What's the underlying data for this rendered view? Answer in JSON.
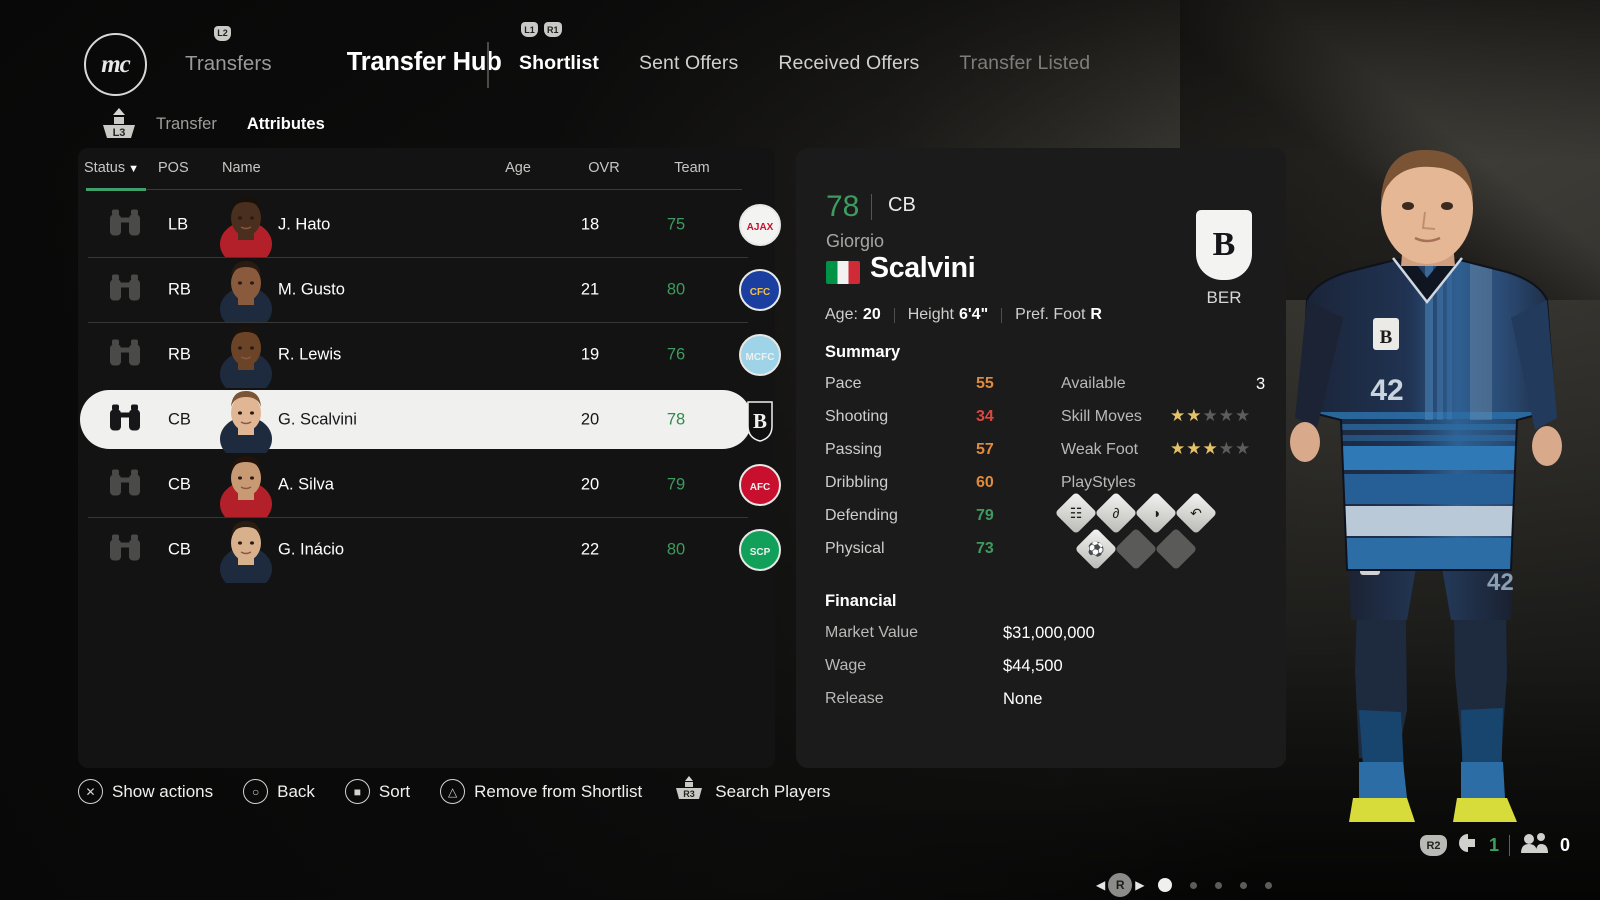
{
  "header": {
    "logo_text": "mc",
    "prev_label": "Transfers",
    "title": "Transfer Hub",
    "l2_tag": "L2",
    "l1_tag": "L1",
    "r1_tag": "R1",
    "tabs": [
      {
        "label": "Shortlist",
        "state": "active"
      },
      {
        "label": "Sent Offers",
        "state": "normal"
      },
      {
        "label": "Received Offers",
        "state": "normal"
      },
      {
        "label": "Transfer Listed",
        "state": "dim"
      }
    ]
  },
  "subnav": {
    "l3_tag": "L3",
    "items": [
      {
        "label": "Transfer",
        "state": "normal"
      },
      {
        "label": "Attributes",
        "state": "active"
      }
    ]
  },
  "list": {
    "columns": [
      "Status",
      "POS",
      "Name",
      "Age",
      "OVR",
      "Team"
    ],
    "sort_caret": "▼",
    "sort_column": "Status",
    "rows": [
      {
        "pos": "LB",
        "name": "J. Hato",
        "age": "18",
        "ovr": "75",
        "team": "Ajax",
        "selected": false
      },
      {
        "pos": "RB",
        "name": "M. Gusto",
        "age": "21",
        "ovr": "80",
        "team": "Chelsea",
        "selected": false
      },
      {
        "pos": "RB",
        "name": "R. Lewis",
        "age": "19",
        "ovr": "76",
        "team": "Manchester City",
        "selected": false
      },
      {
        "pos": "CB",
        "name": "G. Scalvini",
        "age": "20",
        "ovr": "78",
        "team": "Bergamo Calcio",
        "selected": true
      },
      {
        "pos": "CB",
        "name": "A. Silva",
        "age": "20",
        "ovr": "79",
        "team": "Arsenal",
        "selected": false
      },
      {
        "pos": "CB",
        "name": "G. Inácio",
        "age": "22",
        "ovr": "80",
        "team": "Sporting CP",
        "selected": false
      }
    ]
  },
  "player": {
    "overall": "78",
    "position": "CB",
    "first_name": "Giorgio",
    "last_name": "Scalvini",
    "nationality": "Italy",
    "age_label": "Age:",
    "age_value": "20",
    "height_label": "Height",
    "height_value": "6'4\"",
    "foot_label": "Pref. Foot",
    "foot_value": "R",
    "club_initial": "B",
    "club_abbr": "BER",
    "kit_number": "42",
    "summary_title": "Summary",
    "attributes": [
      {
        "label": "Pace",
        "value": "55",
        "color": "#e08a3c"
      },
      {
        "label": "Shooting",
        "value": "34",
        "color": "#d9483f"
      },
      {
        "label": "Passing",
        "value": "57",
        "color": "#e08a3c"
      },
      {
        "label": "Dribbling",
        "value": "60",
        "color": "#e08a3c"
      },
      {
        "label": "Defending",
        "value": "79",
        "color": "#3f9a5f"
      },
      {
        "label": "Physical",
        "value": "73",
        "color": "#3f9a5f"
      }
    ],
    "available_label": "Available",
    "available_value": "3",
    "skill_moves_label": "Skill Moves",
    "skill_moves": 2,
    "skill_moves_max": 5,
    "weak_foot_label": "Weak Foot",
    "weak_foot": 3,
    "weak_foot_max": 5,
    "playstyles_label": "PlayStyles",
    "playstyles": [
      {
        "name": "aerial-playstyle-icon",
        "glyph": "☷",
        "filled": true
      },
      {
        "name": "anticipate-playstyle-icon",
        "glyph": "∂",
        "filled": true
      },
      {
        "name": "block-playstyle-icon",
        "glyph": "◑",
        "filled": true
      },
      {
        "name": "slide-tackle-playstyle-icon",
        "glyph": "↶",
        "filled": true
      },
      {
        "name": "intercept-playstyle-icon",
        "glyph": "⚽",
        "filled": true
      },
      {
        "name": "empty-playstyle-icon",
        "glyph": "",
        "filled": false
      },
      {
        "name": "empty-playstyle-icon",
        "glyph": "",
        "filled": false
      }
    ],
    "financial_title": "Financial",
    "financial": [
      {
        "label": "Market Value",
        "value": "$31,000,000"
      },
      {
        "label": "Wage",
        "value": "$44,500"
      },
      {
        "label": "Release",
        "value": "None"
      }
    ],
    "pager": {
      "r_tag": "R",
      "left_arrow": "◀",
      "right_arrow": "▶",
      "pages": 5,
      "current": 1
    }
  },
  "actionbar": [
    {
      "button": "cross-button",
      "glyph": "✕",
      "label": "Show actions"
    },
    {
      "button": "circle-button",
      "glyph": "○",
      "label": "Back"
    },
    {
      "button": "square-button",
      "glyph": "■",
      "label": "Sort"
    },
    {
      "button": "triangle-button",
      "glyph": "△",
      "label": "Remove from Shortlist"
    },
    {
      "button": "r3-stick-button",
      "glyph": "R3",
      "label": "Search Players"
    }
  ],
  "statusbar": {
    "r2_tag": "R2",
    "volume_icon": "speaker-icon",
    "volume_value": "1",
    "players_icon": "people-icon",
    "players_value": "0"
  }
}
